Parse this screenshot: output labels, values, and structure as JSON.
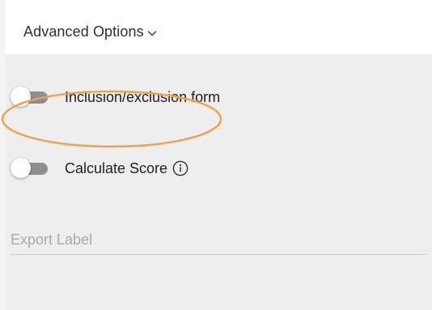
{
  "header": {
    "title": "Advanced Options",
    "chevron_icon": "chevron-down-icon"
  },
  "options": [
    {
      "label": "Inclusion/exclusion form",
      "enabled": false
    },
    {
      "label": "Calculate Score",
      "enabled": false,
      "info_icon": "info-circle-icon"
    }
  ],
  "export_label": {
    "placeholder": "Export Label",
    "value": ""
  },
  "colors": {
    "panel_background": "#efeeee",
    "toggle_track": "#8e8e8e",
    "highlight": "#f0a04b"
  }
}
